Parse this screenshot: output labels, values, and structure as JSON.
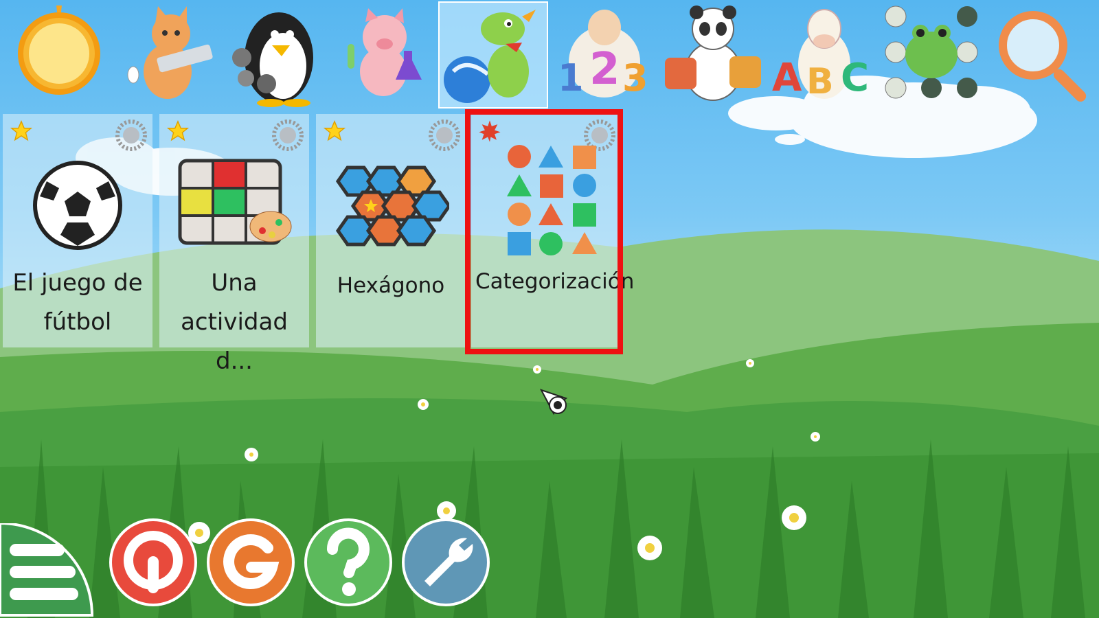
{
  "categories": [
    {
      "name": "sun-icon",
      "label": ""
    },
    {
      "name": "cat-computer-icon",
      "label": ""
    },
    {
      "name": "penguin-gears-icon",
      "label": ""
    },
    {
      "name": "pig-science-icon",
      "label": ""
    },
    {
      "name": "dragon-ball-icon",
      "label": ""
    },
    {
      "name": "sheep-numbers-icon",
      "label": ""
    },
    {
      "name": "panda-puzzle-icon",
      "label": ""
    },
    {
      "name": "cow-letters-icon",
      "label": ""
    },
    {
      "name": "frog-memory-icon",
      "label": ""
    },
    {
      "name": "search-icon",
      "label": ""
    }
  ],
  "selected_category": "dragon-ball-icon",
  "activities": [
    {
      "label": "El juego de fútbol",
      "difficulty_icon": "star-icon"
    },
    {
      "label": "Una actividad d...",
      "difficulty_icon": "star-icon"
    },
    {
      "label": "Hexágono",
      "difficulty_icon": "star-icon"
    },
    {
      "label": "Categorización",
      "difficulty_icon": "red-star-icon"
    }
  ],
  "highlighted_activity": "Categorización",
  "bottom_bar": [
    {
      "name": "exit-button",
      "icon": "power-icon",
      "color": "#e84a3c"
    },
    {
      "name": "about-button",
      "icon": "gcompris-g-icon",
      "color": "#e8782f"
    },
    {
      "name": "help-button",
      "icon": "question-icon",
      "color": "#5cba5c"
    },
    {
      "name": "settings-button",
      "icon": "wrench-icon",
      "color": "#5f97b6"
    }
  ],
  "colors": {
    "sky": "#56b6f0",
    "grass": "#4aa042",
    "highlight": "#ee1111"
  }
}
